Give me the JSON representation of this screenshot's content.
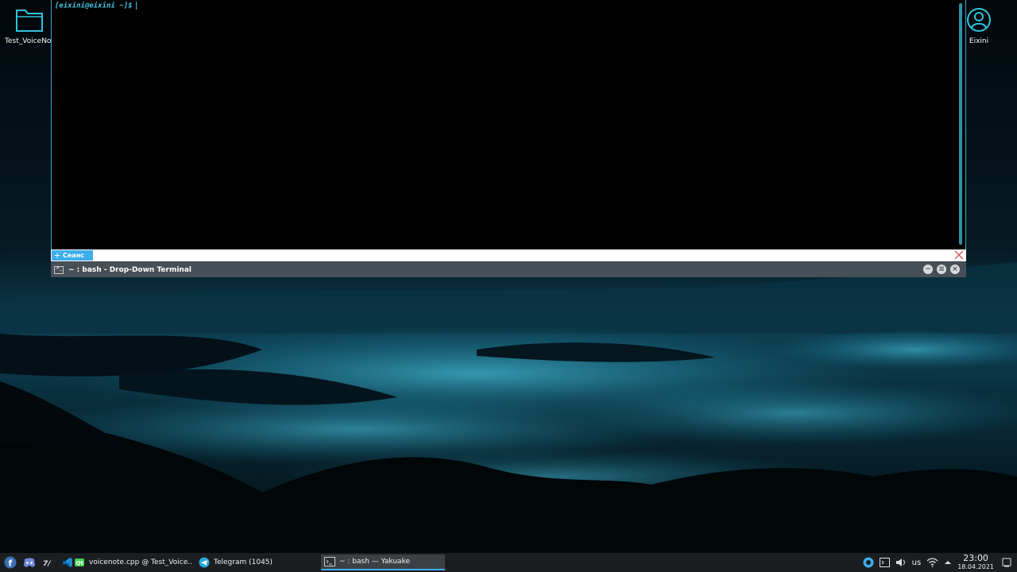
{
  "desktop": {
    "folder_icon_label": "Test_VoiceNot",
    "user_icon_label": "Eixini"
  },
  "terminal": {
    "prompt": "[eixini@eixini ~]$",
    "tab_label": "Сеанс",
    "window_title": "~ : bash - Drop-Down Terminal"
  },
  "taskbar": {
    "tasks": [
      {
        "label": "voicenote.cpp @ Test_Voice...",
        "icon": "qt-creator-icon"
      },
      {
        "label": "Telegram (1045)",
        "icon": "telegram-icon"
      },
      {
        "label": "~ : bash — Yakuake",
        "icon": "terminal-icon"
      }
    ],
    "keyboard_layout": "us",
    "clock_time": "23:00",
    "clock_date": "18.04.2021"
  },
  "colors": {
    "accent": "#3daee9",
    "terminal_bg": "#000000",
    "titlebar": "#475057",
    "taskbar": "#1a1e21"
  }
}
